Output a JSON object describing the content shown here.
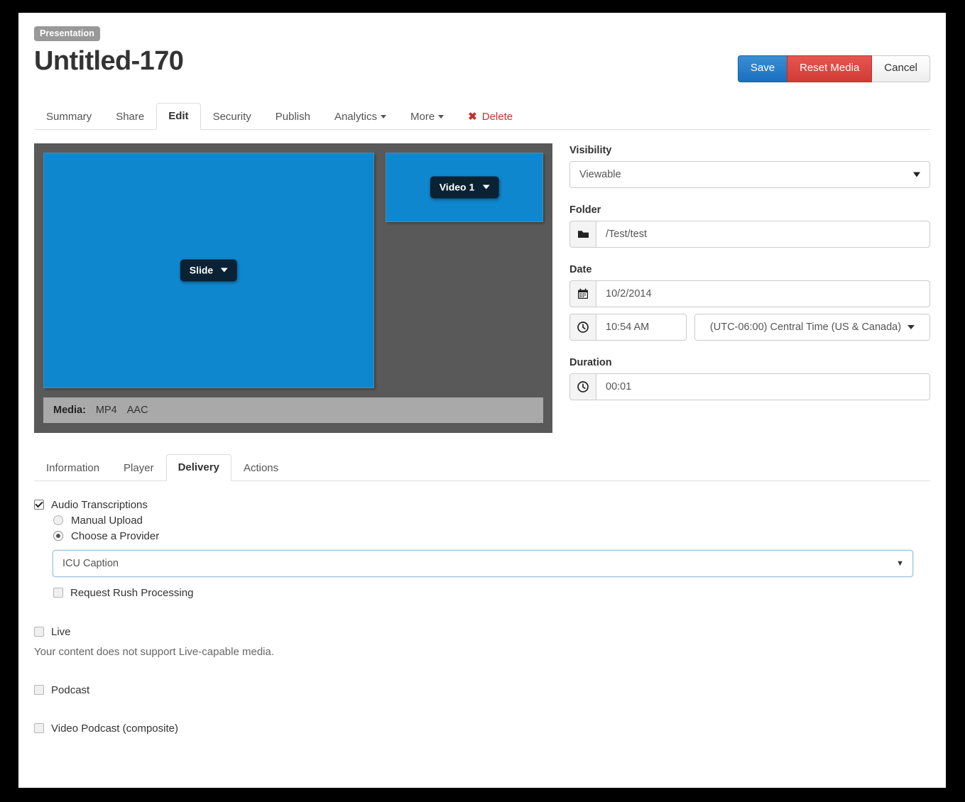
{
  "header": {
    "badge": "Presentation",
    "title": "Untitled-170",
    "buttons": {
      "save": "Save",
      "reset": "Reset Media",
      "cancel": "Cancel"
    },
    "colors": {
      "save_bg": "#1a6fbf",
      "reset_bg": "#d23b35",
      "cancel_bg": "#ededed",
      "badge_bg": "#999999",
      "delete_text": "#c9302c"
    }
  },
  "main_tabs": [
    {
      "label": "Summary",
      "active": false,
      "caret": false
    },
    {
      "label": "Share",
      "active": false,
      "caret": false
    },
    {
      "label": "Edit",
      "active": true,
      "caret": false
    },
    {
      "label": "Security",
      "active": false,
      "caret": false
    },
    {
      "label": "Publish",
      "active": false,
      "caret": false
    },
    {
      "label": "Analytics",
      "active": false,
      "caret": true
    },
    {
      "label": "More",
      "active": false,
      "caret": true
    },
    {
      "label": "Delete",
      "active": false,
      "caret": false,
      "icon": "x-mark-icon"
    }
  ],
  "preview": {
    "slide_pill": "Slide",
    "video_pill": "Video 1",
    "media_label": "Media:",
    "media_formats": [
      "MP4",
      "AAC"
    ],
    "colors": {
      "panel_blue": "#0f87ce",
      "backdrop_gray": "#595959",
      "media_bar_gray": "#a9a9a9",
      "pill_dark": "#0a2233"
    }
  },
  "form": {
    "visibility": {
      "label": "Visibility",
      "value": "Viewable",
      "icon": "chevron-down-icon"
    },
    "folder": {
      "label": "Folder",
      "value": "/Test/test",
      "icon": "folder-icon"
    },
    "date": {
      "label": "Date",
      "value": "10/2/2014",
      "icon": "calendar-icon"
    },
    "time": {
      "value": "10:54 AM",
      "icon": "clock-icon"
    },
    "timezone": {
      "value": "(UTC-06:00) Central Time (US & Canada)",
      "icon": "chevron-down-icon"
    },
    "duration": {
      "label": "Duration",
      "value": "00:01",
      "icon": "clock-icon"
    }
  },
  "sub_tabs": [
    {
      "label": "Information",
      "active": false
    },
    {
      "label": "Player",
      "active": false
    },
    {
      "label": "Delivery",
      "active": true
    },
    {
      "label": "Actions",
      "active": false
    }
  ],
  "delivery": {
    "audio_transcriptions": {
      "label": "Audio Transcriptions",
      "checked": true
    },
    "manual_upload": {
      "label": "Manual Upload",
      "selected": false
    },
    "choose_provider": {
      "label": "Choose a Provider",
      "selected": true
    },
    "provider": {
      "value": "ICU Caption",
      "icon": "chevron-down-icon"
    },
    "rush": {
      "label": "Request Rush Processing",
      "checked": false
    },
    "live": {
      "label": "Live",
      "checked": false,
      "hint": "Your content does not support Live-capable media."
    },
    "podcast": {
      "label": "Podcast",
      "checked": false
    },
    "video_podcast": {
      "label": "Video Podcast (composite)",
      "checked": false
    }
  }
}
